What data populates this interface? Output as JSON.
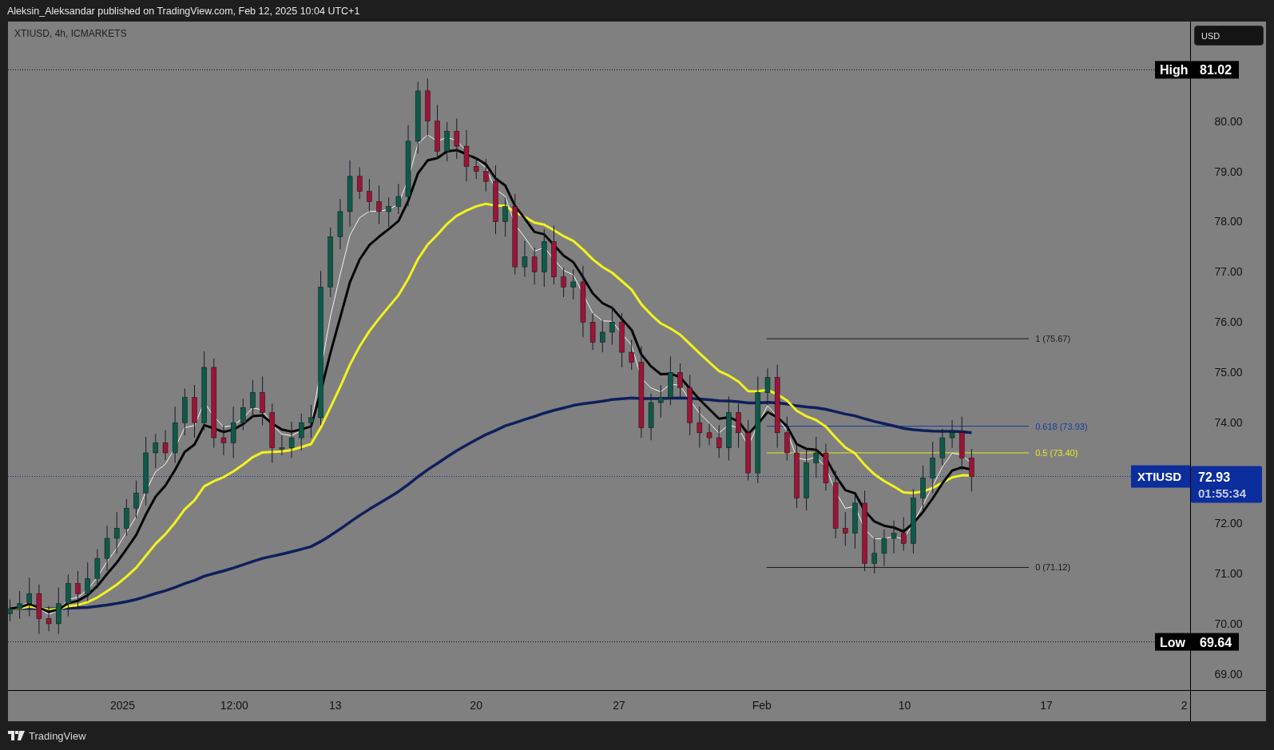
{
  "header": {
    "text": "Aleksin_Aleksandar published on TradingView.com, Feb 12, 2025 10:04 UTC+1"
  },
  "chart": {
    "symbol_line": "XTIUSD, 4h, ICMARKETS",
    "currency_button": "USD",
    "price_axis": {
      "labels": [
        "80.00",
        "79.00",
        "78.00",
        "77.00",
        "76.00",
        "75.00",
        "74.00",
        "72.00",
        "71.00",
        "70.00",
        "69.00"
      ]
    },
    "time_axis": {
      "labels": [
        "2025",
        "12:00",
        "13",
        "20",
        "27",
        "Feb",
        "10",
        "17",
        "2"
      ]
    },
    "fib_levels": [
      {
        "text": "1 (75.67)",
        "color": "#1a1a1a"
      },
      {
        "text": "0.618 (73.93)",
        "color": "#1c3a9e"
      },
      {
        "text": "0.5 (73.40)",
        "color": "#e6e62a"
      },
      {
        "text": "0 (71.12)",
        "color": "#1a1a1a"
      }
    ],
    "high_tag": {
      "label": "High",
      "value": "81.02"
    },
    "low_tag": {
      "label": "Low",
      "value": "69.64"
    },
    "last_price_tag": {
      "symbol": "XTIUSD",
      "price": "72.93",
      "countdown": "01:55:34"
    }
  },
  "footer": {
    "brand": "TradingView"
  }
}
